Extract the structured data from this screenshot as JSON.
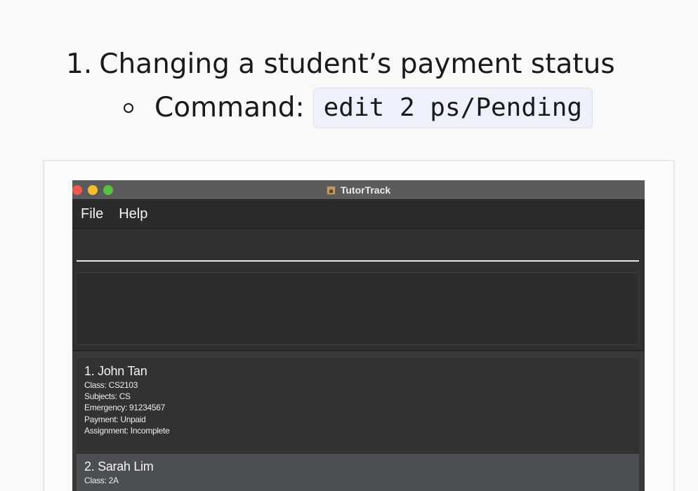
{
  "doc": {
    "step_number": "1.",
    "step_text": "Changing a student’s payment status",
    "command_label": "Command:",
    "command_code": "edit 2 ps/Pending"
  },
  "window": {
    "title": "TutorTrack",
    "menu": [
      "File",
      "Help"
    ],
    "command_input": {
      "value": "",
      "placeholder": ""
    },
    "result_text": ""
  },
  "students": [
    {
      "name": "1. John Tan",
      "fields": [
        "Class: CS2103",
        "Subjects: CS",
        "Emergency: 91234567",
        "Payment: Unpaid",
        "Assignment: Incomplete"
      ]
    },
    {
      "name": "2. Sarah Lim",
      "fields": [
        "Class: 2A"
      ]
    }
  ],
  "colors": {
    "close": "#ee5a52",
    "minimize": "#f5be2f",
    "maximize": "#56c340",
    "code_bg": "#eef0fb",
    "selected_card": "#4b4f53"
  },
  "icons": {
    "bullet": "hollow-circle",
    "app": "tutortrack-app-icon"
  }
}
